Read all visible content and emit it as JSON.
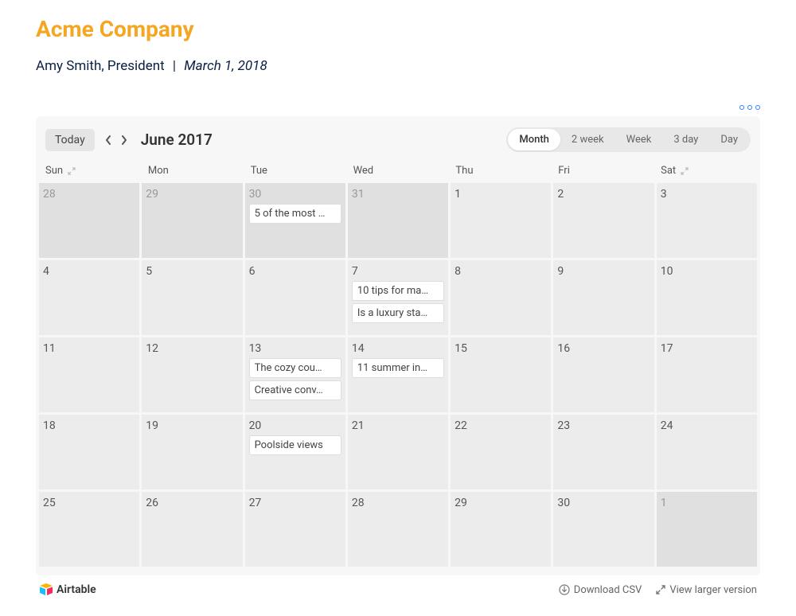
{
  "page": {
    "title": "Acme Company",
    "author": "Amy Smith, President",
    "date": "March 1, 2018"
  },
  "calendar": {
    "today_label": "Today",
    "month_label": "June 2017",
    "views": {
      "month": "Month",
      "two_week": "2 week",
      "week": "Week",
      "three_day": "3 day",
      "day": "Day"
    },
    "day_headers": [
      "Sun",
      "Mon",
      "Tue",
      "Wed",
      "Thu",
      "Fri",
      "Sat"
    ],
    "weeks": [
      [
        {
          "num": "28",
          "outside": true,
          "events": []
        },
        {
          "num": "29",
          "outside": true,
          "events": []
        },
        {
          "num": "30",
          "outside": true,
          "events": [
            "5 of the most …"
          ]
        },
        {
          "num": "31",
          "outside": true,
          "events": []
        },
        {
          "num": "1",
          "outside": false,
          "events": []
        },
        {
          "num": "2",
          "outside": false,
          "events": []
        },
        {
          "num": "3",
          "outside": false,
          "events": []
        }
      ],
      [
        {
          "num": "4",
          "outside": false,
          "events": []
        },
        {
          "num": "5",
          "outside": false,
          "events": []
        },
        {
          "num": "6",
          "outside": false,
          "events": []
        },
        {
          "num": "7",
          "outside": false,
          "events": [
            "10 tips for ma…",
            "Is a luxury sta…"
          ]
        },
        {
          "num": "8",
          "outside": false,
          "events": []
        },
        {
          "num": "9",
          "outside": false,
          "events": []
        },
        {
          "num": "10",
          "outside": false,
          "events": []
        }
      ],
      [
        {
          "num": "11",
          "outside": false,
          "events": []
        },
        {
          "num": "12",
          "outside": false,
          "events": []
        },
        {
          "num": "13",
          "outside": false,
          "events": [
            "The cozy cou…",
            "Creative conv…"
          ]
        },
        {
          "num": "14",
          "outside": false,
          "events": [
            "11 summer in…"
          ]
        },
        {
          "num": "15",
          "outside": false,
          "events": []
        },
        {
          "num": "16",
          "outside": false,
          "events": []
        },
        {
          "num": "17",
          "outside": false,
          "events": []
        }
      ],
      [
        {
          "num": "18",
          "outside": false,
          "events": []
        },
        {
          "num": "19",
          "outside": false,
          "events": []
        },
        {
          "num": "20",
          "outside": false,
          "events": [
            "Poolside views"
          ]
        },
        {
          "num": "21",
          "outside": false,
          "events": []
        },
        {
          "num": "22",
          "outside": false,
          "events": []
        },
        {
          "num": "23",
          "outside": false,
          "events": []
        },
        {
          "num": "24",
          "outside": false,
          "events": []
        }
      ],
      [
        {
          "num": "25",
          "outside": false,
          "events": []
        },
        {
          "num": "26",
          "outside": false,
          "events": []
        },
        {
          "num": "27",
          "outside": false,
          "events": []
        },
        {
          "num": "28",
          "outside": false,
          "events": []
        },
        {
          "num": "29",
          "outside": false,
          "events": []
        },
        {
          "num": "30",
          "outside": false,
          "events": []
        },
        {
          "num": "1",
          "outside": true,
          "events": []
        }
      ]
    ]
  },
  "footer": {
    "brand": "Airtable",
    "download": "Download CSV",
    "larger": "View larger version"
  }
}
